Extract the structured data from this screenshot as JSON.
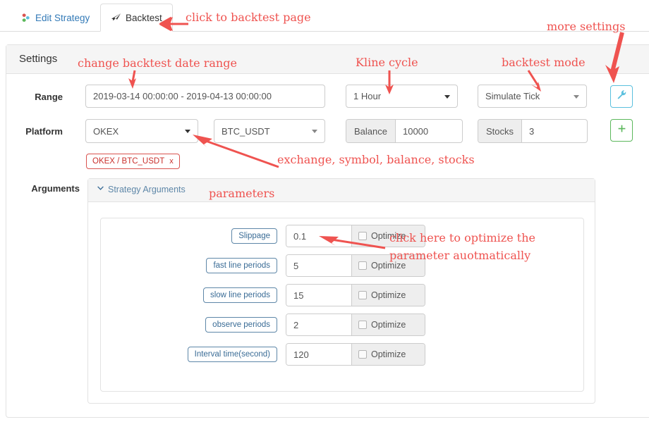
{
  "tabs": [
    {
      "label": "Edit Strategy",
      "icon": "puzzle-icon",
      "active": false
    },
    {
      "label": "Backtest",
      "icon": "rocket-icon",
      "active": true
    }
  ],
  "panel": {
    "title": "Settings"
  },
  "form": {
    "range_label": "Range",
    "range_value": "2019-03-14 00:00:00 - 2019-04-13 00:00:00",
    "kline_cycle_value": "1 Hour",
    "backtest_mode_value": "Simulate Tick",
    "settings_button_icon": "wrench-icon",
    "platform_label": "Platform",
    "exchange_value": "OKEX",
    "symbol_value": "BTC_USDT",
    "balance_label": "Balance",
    "balance_value": "10000",
    "stocks_label": "Stocks",
    "stocks_value": "3",
    "add_button_icon": "plus-icon",
    "chip_label": "OKEX / BTC_USDT",
    "chip_remove": "x",
    "arguments_label": "Arguments"
  },
  "arguments_panel": {
    "header_title": "Strategy Arguments",
    "header_icon": "chevron-down-icon",
    "optimize_label": "Optimize",
    "params": [
      {
        "name": "Slippage",
        "value": "0.1",
        "optimize": false
      },
      {
        "name": "fast line periods",
        "value": "5",
        "optimize": false
      },
      {
        "name": "slow line periods",
        "value": "15",
        "optimize": false
      },
      {
        "name": "observe periods",
        "value": "2",
        "optimize": false
      },
      {
        "name": "Interval time(second)",
        "value": "120",
        "optimize": false
      }
    ]
  },
  "annotations": {
    "color": "#ef5350",
    "click_backtest": "click to backtest page",
    "more_settings": "more settings",
    "change_date_range": "change backtest date range",
    "kline_cycle": "Kline cycle",
    "backtest_mode": "backtest mode",
    "exchange_symbol": "exchange, symbol, balance, stocks",
    "parameters": "parameters",
    "optimize_line1": "click here to optimize the",
    "optimize_line2": "parameter auotmatically"
  }
}
